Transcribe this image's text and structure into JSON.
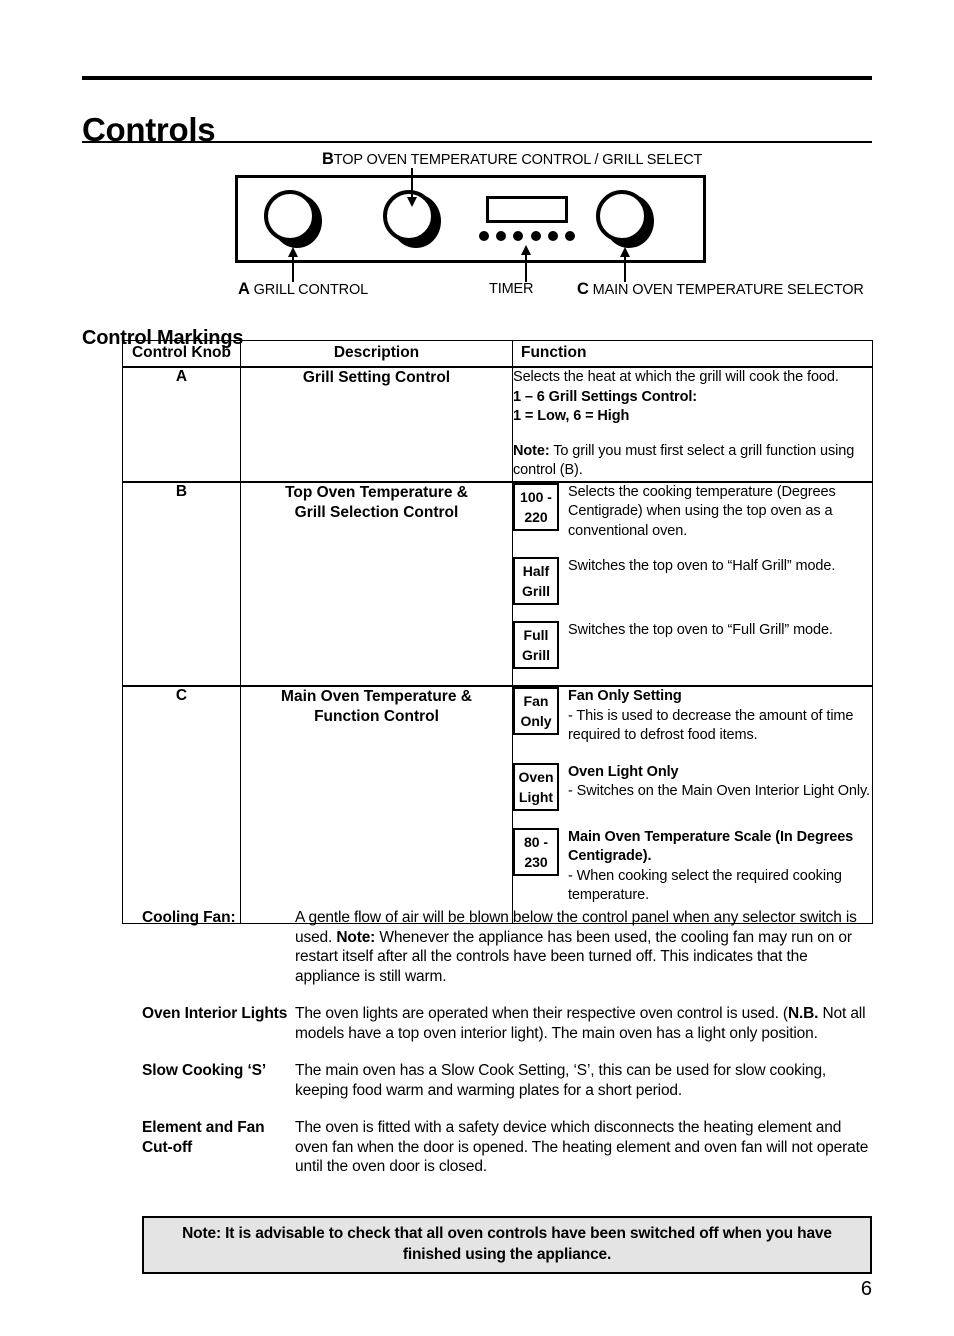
{
  "page_title": "Controls",
  "diagram": {
    "label_b_prefix": "B",
    "label_b": "TOP OVEN TEMPERATURE CONTROL / GRILL SELECT",
    "label_a_prefix": "A",
    "label_a": "GRILL CONTROL",
    "label_timer": "TIMER",
    "label_c_prefix": "C",
    "label_c": "MAIN OVEN TEMPERATURE SELECTOR",
    "timer_dot_count": 6
  },
  "section_heading": "Control Markings",
  "table": {
    "headers": {
      "knob": "Control Knob",
      "description": "Description",
      "function": "Function"
    },
    "rows": [
      {
        "knob": "A",
        "description": "Grill Setting Control",
        "function_lines": [
          {
            "text": "Selects the heat at which the grill will cook the food.",
            "bold": false
          },
          {
            "text": "1 – 6 Grill Settings Control:",
            "bold": true
          },
          {
            "text": "1 = Low, 6 = High",
            "bold": true
          },
          {
            "text": "",
            "bold": false,
            "spacer": true
          },
          {
            "text_bold": "Note:",
            "text": " To grill you must first select a grill function using control (B).",
            "bold": false
          }
        ]
      },
      {
        "knob": "B",
        "description": "Top Oven Temperature &\nGrill Selection Control",
        "markings": [
          {
            "box": "100 -\n220",
            "title": "",
            "body": "Selects the cooking temperature (Degrees Centigrade) when using the top oven as a conventional oven."
          },
          {
            "box": "Half\nGrill",
            "title": "",
            "body": "Switches the top oven to “Half Grill” mode."
          },
          {
            "box": "Full\nGrill",
            "title": "",
            "body": "Switches the top oven to “Full Grill” mode."
          }
        ]
      },
      {
        "knob": "C",
        "description": "Main Oven Temperature &\nFunction Control",
        "markings": [
          {
            "box": "Fan\nOnly",
            "title": "Fan Only Setting",
            "body": "-  This is used to decrease the amount of time required to defrost food items."
          },
          {
            "box": "Oven\nLight",
            "title": "Oven Light Only",
            "body": "-  Switches on the Main Oven Interior Light Only."
          },
          {
            "box": "80 -\n230",
            "title": "Main Oven Temperature Scale (In Degrees Centigrade).",
            "body": "-  When cooking select the required cooking temperature."
          }
        ]
      }
    ]
  },
  "definitions": [
    {
      "term": "Cooling Fan:",
      "body_1": "A gentle flow of air will be blown below the control panel when any selector switch is used.",
      "body_bold": "Note:",
      "body_2": " Whenever the appliance has been used, the cooling fan may run on or restart itself after all the controls have been turned off. This indicates that the appliance is still warm."
    },
    {
      "term": "Oven Interior Lights",
      "body_1": "The oven lights are operated when their respective oven control is used. (",
      "body_bold": "N.B.",
      "body_2": " Not all models have a top oven interior light). The main oven has a light only position."
    },
    {
      "term": "Slow Cooking ‘S’",
      "body_1": "The main oven  has a Slow Cook Setting, ‘S’, this can be used for slow cooking, keeping food warm and warming plates for a short period.",
      "body_bold": "",
      "body_2": ""
    },
    {
      "term": "Element and Fan Cut-off",
      "body_1": "The oven is fitted with a safety device which disconnects the heating element and oven fan when the door is opened. The heating element and oven fan will not operate until the oven door is closed.",
      "body_bold": "",
      "body_2": ""
    }
  ],
  "final_note": "Note: It is advisable to check that all oven controls have been switched off when you have finished using the appliance.",
  "page_number": "6",
  "colors": {
    "ink": "#000000",
    "paper": "#ffffff",
    "note_fill": "#e4e4e4"
  }
}
